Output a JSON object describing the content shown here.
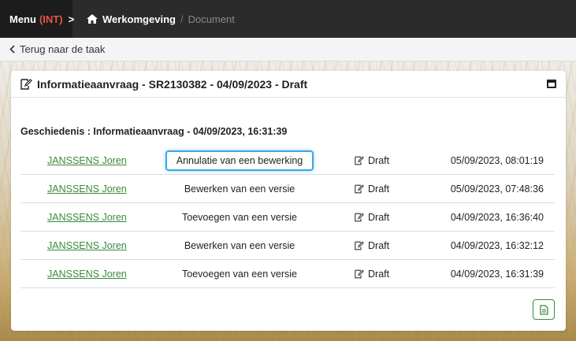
{
  "topbar": {
    "menu_label": "Menu",
    "env_label": "(INT)",
    "menu_chevron": ">",
    "home_label": "Werkomgeving",
    "separator": "/",
    "current_label": "Document"
  },
  "subbar": {
    "back_label": "Terug naar de taak"
  },
  "card": {
    "title": "Informatieaanvraag - SR2130382 - 04/09/2023 - Draft",
    "section_title": "Geschiedenis : Informatieaanvraag - 04/09/2023, 16:31:39",
    "rows": [
      {
        "user": "JANSSENS Joren",
        "action": "Annulatie van een bewerking",
        "status": "Draft",
        "date": "05/09/2023, 08:01:19"
      },
      {
        "user": "JANSSENS Joren",
        "action": "Bewerken van een versie",
        "status": "Draft",
        "date": "05/09/2023, 07:48:36"
      },
      {
        "user": "JANSSENS Joren",
        "action": "Toevoegen van een versie",
        "status": "Draft",
        "date": "04/09/2023, 16:36:40"
      },
      {
        "user": "JANSSENS Joren",
        "action": "Bewerken van een versie",
        "status": "Draft",
        "date": "04/09/2023, 16:32:12"
      },
      {
        "user": "JANSSENS Joren",
        "action": "Toevoegen van een versie",
        "status": "Draft",
        "date": "04/09/2023, 16:31:39"
      }
    ]
  },
  "colors": {
    "topbar_bg": "#2b2b2b",
    "env_accent": "#e8554a",
    "link_green": "#3a8a3a",
    "highlight_blue": "#3aa8e6"
  },
  "icons": {
    "home": "home-icon",
    "back": "chevron-left-icon",
    "title": "edit-document-icon",
    "window": "window-icon",
    "status": "edit-document-icon",
    "document": "document-icon"
  }
}
